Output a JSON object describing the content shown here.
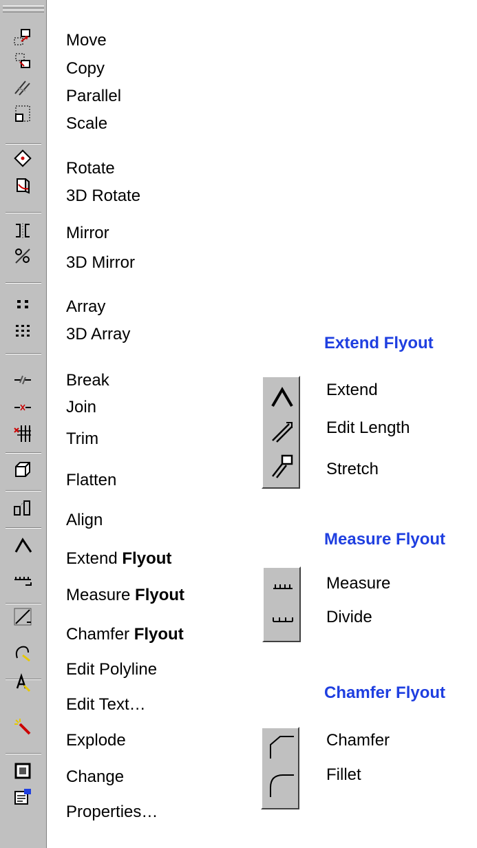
{
  "toolbar": {
    "items": [
      {
        "icon": "move-icon",
        "label": "Move"
      },
      {
        "icon": "copy-icon",
        "label": "Copy"
      },
      {
        "icon": "parallel-icon",
        "label": "Parallel"
      },
      {
        "icon": "scale-icon",
        "label": "Scale"
      },
      {
        "icon": "rotate-icon",
        "label": "Rotate"
      },
      {
        "icon": "rotate-3d-icon",
        "label": "3D Rotate"
      },
      {
        "icon": "mirror-icon",
        "label": "Mirror"
      },
      {
        "icon": "mirror-3d-icon",
        "label": "3D Mirror"
      },
      {
        "icon": "array-icon",
        "label": "Array"
      },
      {
        "icon": "array-3d-icon",
        "label": "3D Array"
      },
      {
        "icon": "break-icon",
        "label": "Break"
      },
      {
        "icon": "join-icon",
        "label": "Join"
      },
      {
        "icon": "trim-icon",
        "label": "Trim"
      },
      {
        "icon": "flatten-icon",
        "label": "Flatten"
      },
      {
        "icon": "align-icon",
        "label": "Align"
      },
      {
        "icon": "extend-icon",
        "label": "Extend",
        "suffix": "Flyout"
      },
      {
        "icon": "measure-icon",
        "label": "Measure",
        "suffix": "Flyout"
      },
      {
        "icon": "chamfer-icon",
        "label": "Chamfer",
        "suffix": "Flyout"
      },
      {
        "icon": "edit-polyline-icon",
        "label": "Edit Polyline"
      },
      {
        "icon": "edit-text-icon",
        "label": "Edit Text…"
      },
      {
        "icon": "explode-icon",
        "label": "Explode"
      },
      {
        "icon": "change-icon",
        "label": "Change"
      },
      {
        "icon": "properties-icon",
        "label": "Properties…"
      }
    ]
  },
  "flyouts": {
    "extend": {
      "title": "Extend Flyout",
      "items": [
        {
          "icon": "extend-icon",
          "label": "Extend"
        },
        {
          "icon": "edit-length-icon",
          "label": "Edit Length"
        },
        {
          "icon": "stretch-icon",
          "label": "Stretch"
        }
      ]
    },
    "measure": {
      "title": "Measure Flyout",
      "items": [
        {
          "icon": "measure-icon",
          "label": "Measure"
        },
        {
          "icon": "divide-icon",
          "label": "Divide"
        }
      ]
    },
    "chamfer": {
      "title": "Chamfer Flyout",
      "items": [
        {
          "icon": "chamfer-icon",
          "label": "Chamfer"
        },
        {
          "icon": "fillet-icon",
          "label": "Fillet"
        }
      ]
    }
  },
  "colors": {
    "flyout_title": "#1f3fe0",
    "toolbar_bg": "#c0c0c0"
  }
}
